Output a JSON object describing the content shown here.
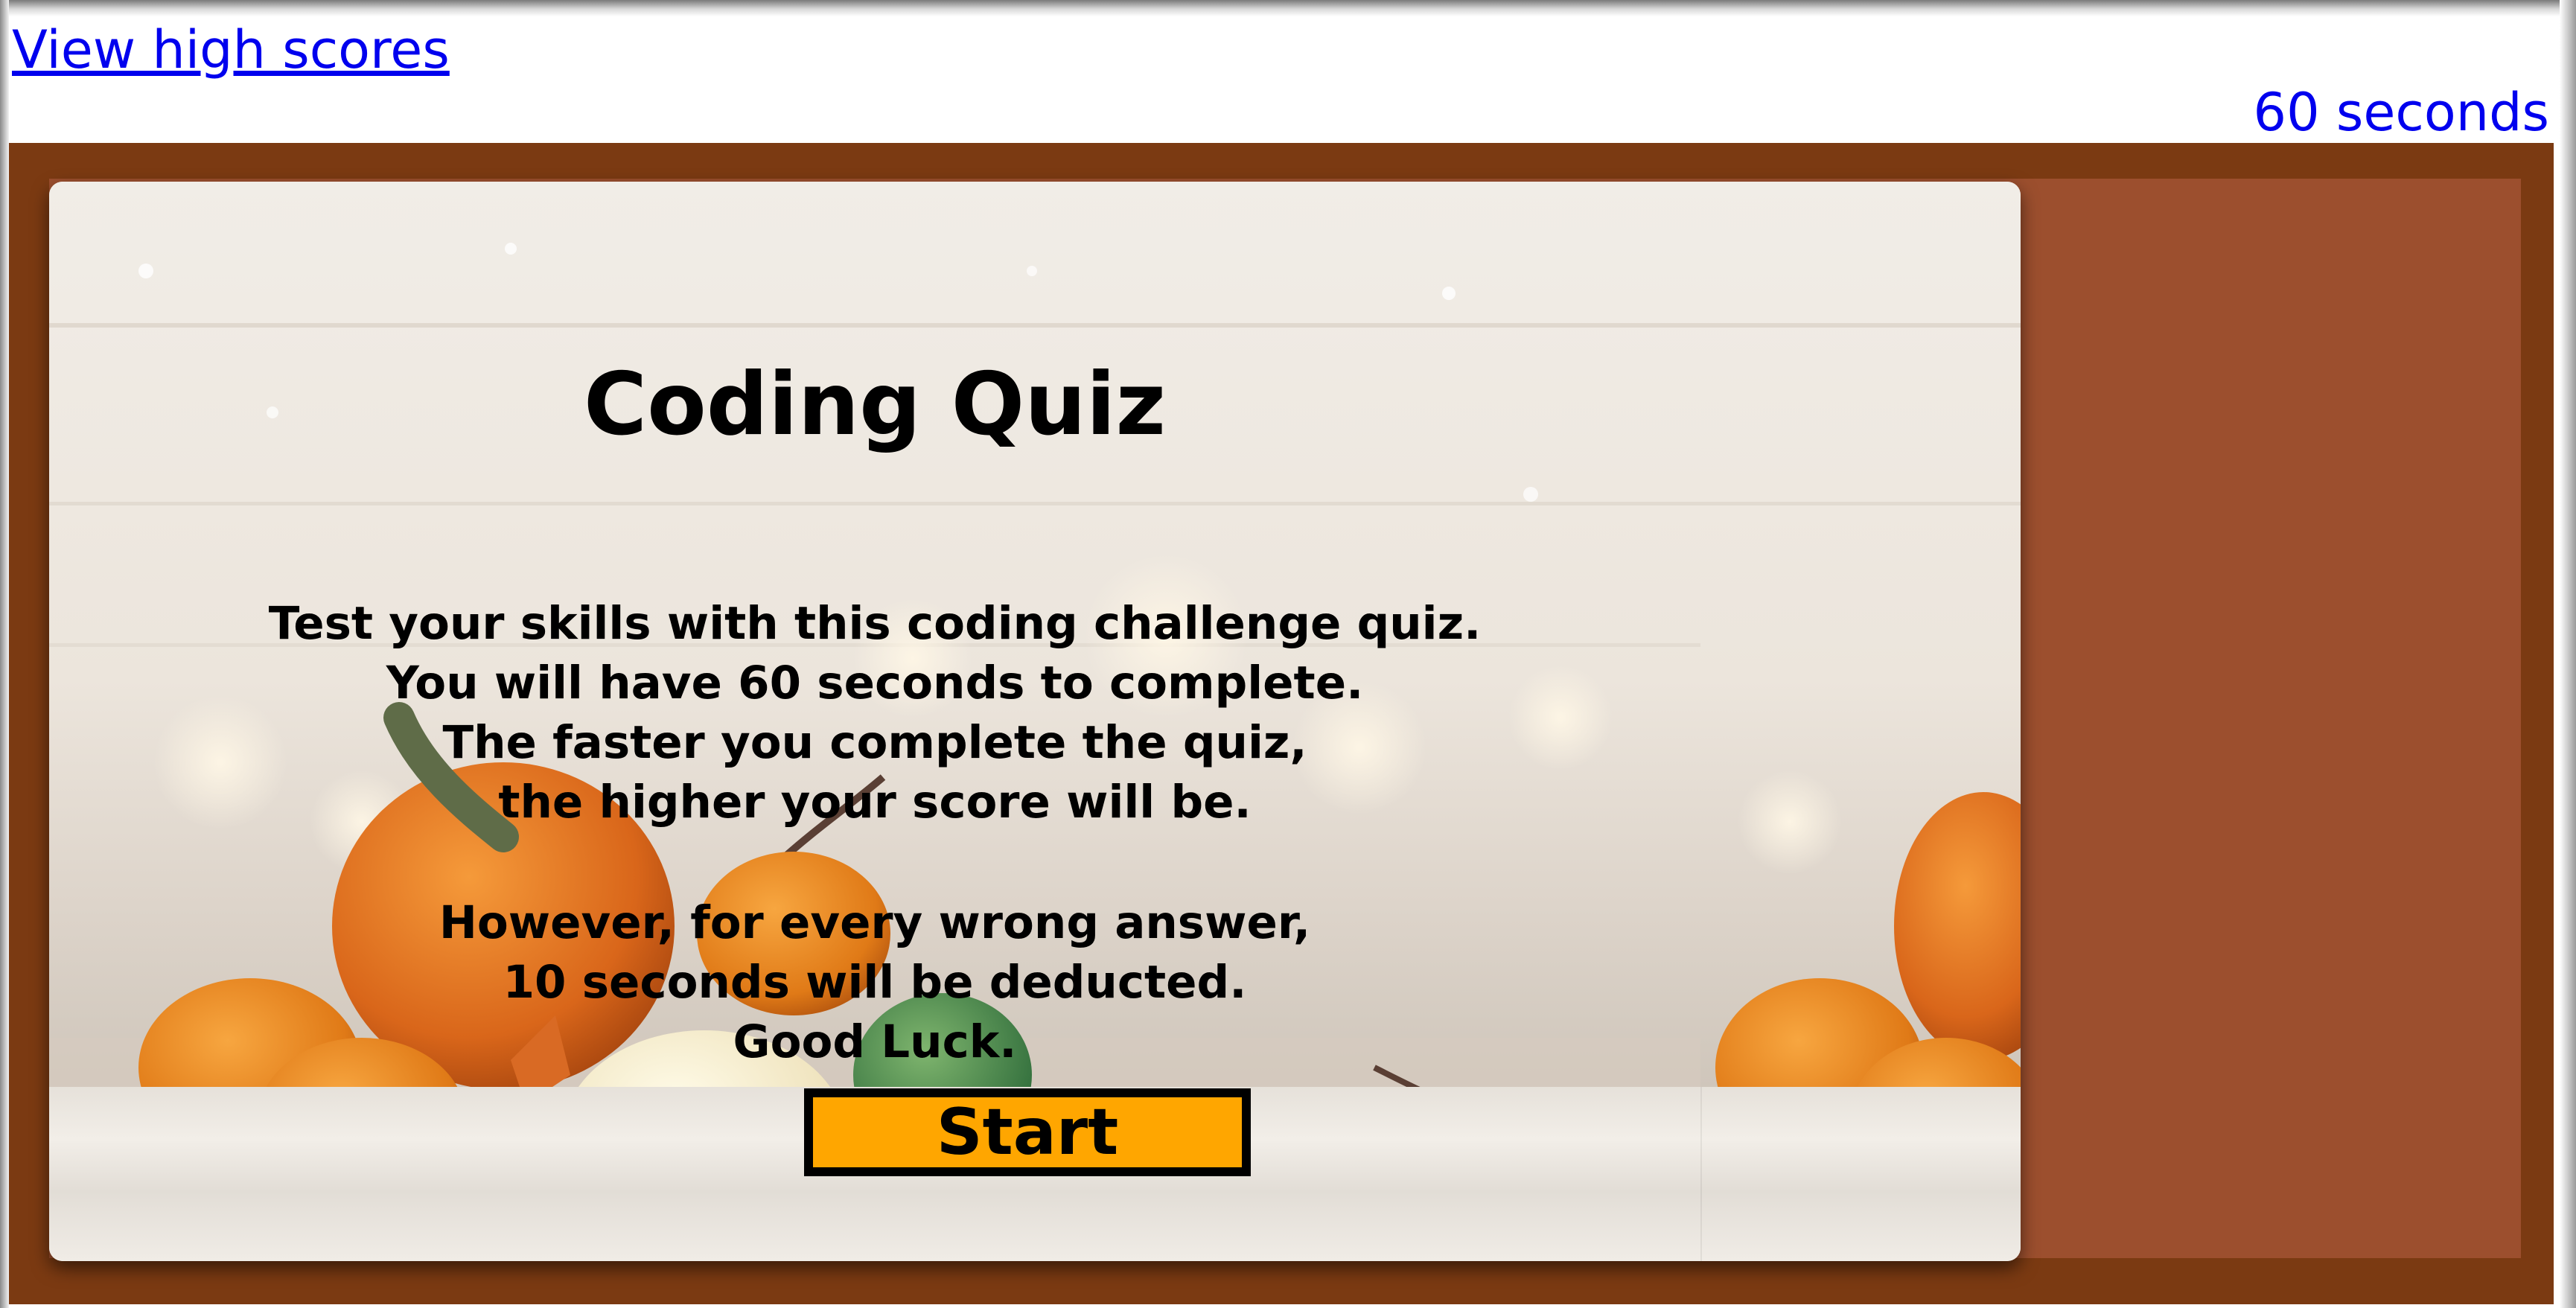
{
  "header": {
    "highscores_link": "View high scores",
    "timer": "60 seconds"
  },
  "quiz": {
    "title": "Coding Quiz",
    "intro_lines": [
      "Test your skills with this coding challenge quiz.",
      "You will have 60 seconds to complete.",
      "The faster you complete the quiz,",
      "the higher your score will be."
    ],
    "warning_lines": [
      "However, for every wrong answer,",
      "10 seconds will be deducted.",
      "Good Luck."
    ],
    "start_label": "Start"
  },
  "colors": {
    "link": "#0000ee",
    "band": "#7b3a12",
    "panel": "#9c4f2e",
    "button": "#ffa600"
  }
}
